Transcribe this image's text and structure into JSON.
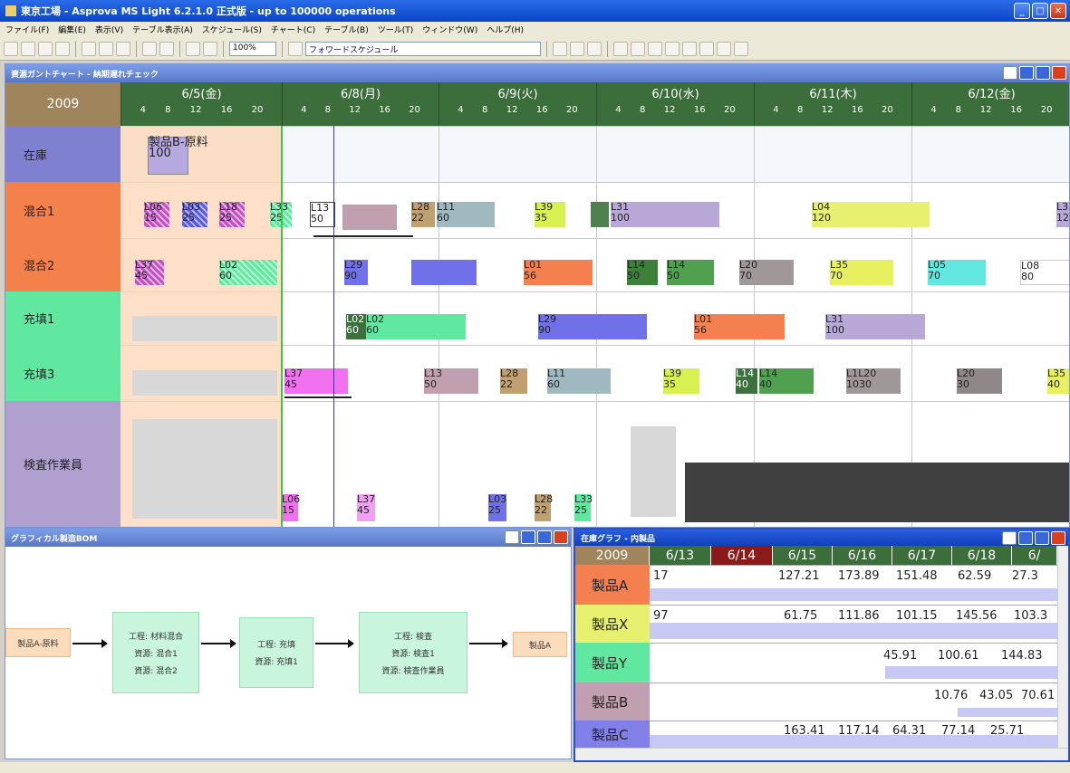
{
  "app": {
    "title": "東京工場 - Asprova MS Light 6.2.1.0 正式版 - up to 100000 operations"
  },
  "menu": [
    "ファイル(F)",
    "編集(E)",
    "表示(V)",
    "テーブル表示(A)",
    "スケジュール(S)",
    "チャート(C)",
    "テーブル(B)",
    "ツール(T)",
    "ウィンドウ(W)",
    "ヘルプ(H)"
  ],
  "toolbar": {
    "zoom": "100%",
    "schedule_select": "フォワードスケジュール"
  },
  "gantt": {
    "title": "資源ガントチャート - 納期遅れチェック",
    "year": "2009",
    "days": [
      "6/5(金)",
      "6/8(月)",
      "6/9(火)",
      "6/10(水)",
      "6/11(木)",
      "6/12(金)"
    ],
    "ticks": [
      "4",
      "8",
      "12",
      "16",
      "20"
    ],
    "resources": [
      "在庫",
      "混合1",
      "混合2",
      "充填1",
      "充填3",
      "検査作業員"
    ],
    "stock_label": "製品B-原料",
    "stock_qty": "100",
    "labels": {
      "m1": [
        "L06",
        "15",
        "L03",
        "25",
        "L18",
        "25",
        "L33",
        "25",
        "L13",
        "50",
        "L28",
        "22",
        "L11",
        "60",
        "L39",
        "35",
        "L31",
        "100",
        "L04",
        "120",
        "L3",
        "12"
      ],
      "m2": [
        "L37",
        "45",
        "L02",
        "60",
        "L29",
        "90",
        "L01",
        "56",
        "L14",
        "50",
        "L14",
        "50",
        "L20",
        "70",
        "L35",
        "70",
        "L05",
        "70",
        "L08",
        "80"
      ],
      "f1": [
        "L02",
        "60",
        "L02",
        "60",
        "L29",
        "90",
        "L01",
        "56",
        "L31",
        "100"
      ],
      "f3": [
        "L37",
        "45",
        "L13",
        "50",
        "L28",
        "22",
        "L11",
        "60",
        "L39",
        "35",
        "L14",
        "40",
        "L14",
        "40",
        "L1",
        "10",
        "L20",
        "40",
        "L20",
        "30",
        "L35",
        "40"
      ],
      "insp": [
        "L06",
        "15",
        "L37",
        "45",
        "L03",
        "25",
        "L28",
        "22",
        "L33",
        "25"
      ]
    }
  },
  "bom": {
    "title": "グラフィカル製造BOM",
    "input_item": "製品A-原料",
    "output_item": "製品A",
    "processes": [
      {
        "name": "工程: 材料混合",
        "res1": "資源: 混合1",
        "res2": "資源: 混合2"
      },
      {
        "name": "工程: 充填",
        "res1": "資源: 充填1",
        "res2": ""
      },
      {
        "name": "工程: 検査",
        "res1": "資源: 検査1",
        "res2": "資源: 検査作業員"
      }
    ]
  },
  "inventory": {
    "title": "在庫グラフ - 内製品",
    "year": "2009",
    "dates": [
      "6/13",
      "6/14",
      "6/15",
      "6/16",
      "6/17",
      "6/18",
      "6/"
    ],
    "rows": [
      {
        "name": "製品A",
        "values": [
          "17",
          "127.21",
          "173.89",
          "151.48",
          "62.59",
          "27.3"
        ]
      },
      {
        "name": "製品X",
        "values": [
          "97",
          "61.75",
          "111.86",
          "101.15",
          "145.56",
          "103.3"
        ]
      },
      {
        "name": "製品Y",
        "values": [
          "45.91",
          "100.61",
          "144.83"
        ]
      },
      {
        "name": "製品B",
        "values": [
          "10.76",
          "43.05",
          "70.61"
        ]
      },
      {
        "name": "製品C",
        "values": [
          "163.41",
          "117.14",
          "64.31",
          "77.14",
          "25.71"
        ]
      }
    ]
  },
  "colors": {
    "header_green": "#3c6e3c",
    "year_tan": "#a0855c",
    "now_line": "#38c838",
    "past_area": "#fcd5b4"
  }
}
